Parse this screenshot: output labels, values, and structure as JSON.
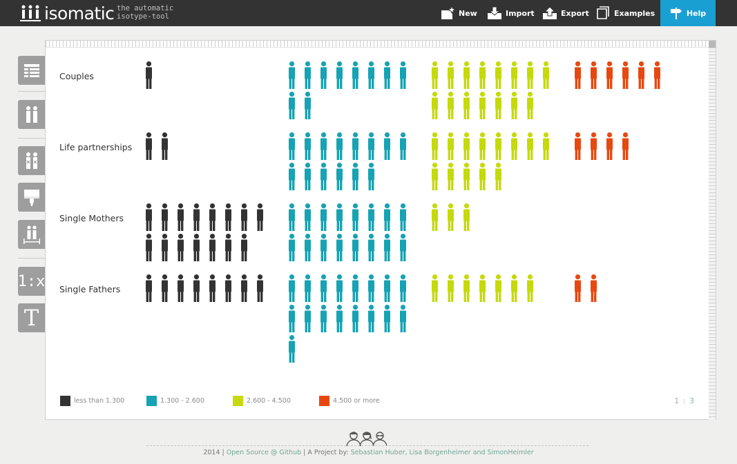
{
  "app": {
    "logo_text": "isomatic",
    "tagline_line1": "the automatic",
    "tagline_line2": "isotype-tool"
  },
  "nav": {
    "new_label": "New",
    "import_label": "Import",
    "export_label": "Export",
    "examples_label": "Examples",
    "help_label": "Help"
  },
  "toolbar": {
    "items": [
      {
        "name": "data-table-tool",
        "icon": "table-icon"
      },
      {
        "name": "icons-tool",
        "icon": "people-icon"
      },
      {
        "name": "icon-select-tool",
        "icon": "people-x-icon"
      },
      {
        "name": "color-tool",
        "icon": "paint-brush-icon"
      },
      {
        "name": "layout-tool",
        "icon": "people-spacing-icon"
      },
      {
        "name": "ratio-tool",
        "icon": "ratio-icon",
        "text": "1:x"
      },
      {
        "name": "text-tool",
        "icon": "text-icon",
        "text": "T"
      }
    ]
  },
  "chart_data": {
    "type": "isotype",
    "categories": [
      "Couples",
      "Life partnerships",
      "Single Mothers",
      "Single Fathers"
    ],
    "series": [
      {
        "name": "less than 1.300",
        "color": "#333333",
        "values": [
          1,
          2,
          15,
          8
        ]
      },
      {
        "name": "1.300 - 2.600",
        "color": "#16a3b3",
        "values": [
          10,
          14,
          16,
          17
        ]
      },
      {
        "name": "2.600 - 4.500",
        "color": "#c6d90c",
        "values": [
          15,
          13,
          3,
          7
        ]
      },
      {
        "name": "4.500 or more",
        "color": "#e8480f",
        "values": [
          6,
          4,
          0,
          2
        ]
      }
    ],
    "icons_per_line": 8,
    "scale_text": "1 : 3"
  },
  "footer": {
    "year": "2014",
    "sep1": " | ",
    "github_link": "Open Source @ Github",
    "sep2": " | A Project by: ",
    "authors": "Sebastian Huber, Lisa Borgenheimer and SimonHeimler"
  }
}
